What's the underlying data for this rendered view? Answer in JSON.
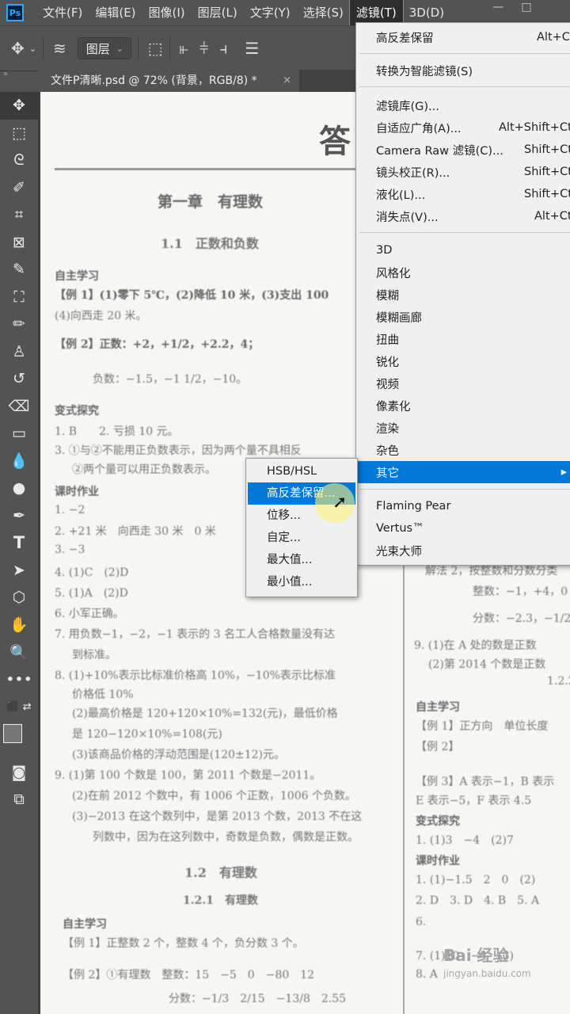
{
  "menubar": {
    "logo": "Ps",
    "items": [
      "文件(F)",
      "编辑(E)",
      "图像(I)",
      "图层(L)",
      "文字(Y)",
      "选择(S)",
      "滤镜(T)",
      "3D(D)"
    ],
    "active_index": 6
  },
  "options_bar": {
    "layer_select_value": "图层"
  },
  "tab": {
    "title": "文件P清晰.psd @ 72% (背景，RGB/8) *",
    "close": "×"
  },
  "toolbox": {
    "tools": [
      "move-tool-icon",
      "marquee-tool-icon",
      "lasso-tool-icon",
      "quick-select-tool-icon",
      "crop-tool-icon",
      "frame-tool-icon",
      "eyedropper-tool-icon",
      "healing-brush-tool-icon",
      "brush-tool-icon",
      "stamp-tool-icon",
      "history-brush-tool-icon",
      "eraser-tool-icon",
      "gradient-tool-icon",
      "blur-tool-icon",
      "dodge-tool-icon",
      "pen-tool-icon",
      "type-tool-icon",
      "path-select-tool-icon",
      "shape-tool-icon",
      "hand-tool-icon",
      "zoom-tool-icon",
      "more-tools-icon"
    ],
    "type_tool_label": "T"
  },
  "filter_menu": {
    "items": [
      {
        "label": "高反差保留",
        "shortcut": "Alt+C"
      },
      {
        "label": "转换为智能滤镜(S)",
        "shortcut": ""
      },
      {
        "label": "滤镜库(G)...",
        "shortcut": ""
      },
      {
        "label": "自适应广角(A)...",
        "shortcut": "Alt+Shift+Ct"
      },
      {
        "label": "Camera Raw 滤镜(C)...",
        "shortcut": "Shift+Ct"
      },
      {
        "label": "镜头校正(R)...",
        "shortcut": "Shift+Ct"
      },
      {
        "label": "液化(L)...",
        "shortcut": "Shift+Ct"
      },
      {
        "label": "消失点(V)...",
        "shortcut": "Alt+Ct"
      },
      {
        "label": "3D",
        "shortcut": ""
      },
      {
        "label": "风格化",
        "shortcut": ""
      },
      {
        "label": "模糊",
        "shortcut": ""
      },
      {
        "label": "模糊画廊",
        "shortcut": ""
      },
      {
        "label": "扭曲",
        "shortcut": ""
      },
      {
        "label": "锐化",
        "shortcut": ""
      },
      {
        "label": "视频",
        "shortcut": ""
      },
      {
        "label": "像素化",
        "shortcut": ""
      },
      {
        "label": "渲染",
        "shortcut": ""
      },
      {
        "label": "杂色",
        "shortcut": ""
      },
      {
        "label": "其它",
        "shortcut": ""
      },
      {
        "label": "Flaming Pear",
        "shortcut": ""
      },
      {
        "label": "Vertus™",
        "shortcut": ""
      },
      {
        "label": "光束大师",
        "shortcut": ""
      }
    ],
    "highlighted": "其它"
  },
  "sub_menu": {
    "items": [
      "HSB/HSL",
      "高反差保留...",
      "位移...",
      "自定...",
      "最大值...",
      "最小值..."
    ],
    "highlighted": "高反差保留..."
  },
  "document": {
    "big_title": "答",
    "chapter": "第一章　有理数",
    "section_1_1": "1.1　正数和负数",
    "lines": [
      "自主学习",
      "【例 1】(1)零下 5℃，(2)降低 10 米，(3)支出 100",
      "(4)向西走 20 米。",
      "【例 2】正数：+2，+1/2，+2.2，4；",
      "负数：−1.5，−1 1/2，−10。",
      "变式探究",
      "1. B　　2. 亏损 10 元。",
      "3. ①与②不能用正负数表示，因为两个量不具相反",
      "②两个量可以用正负数表示。",
      "课时作业",
      "1. −2",
      "2. +21 米　向西走 30 米　0 米",
      "3. −3",
      "4. (1)C　(2)D",
      "5. (1)A　(2)D",
      "6. 小军正确。",
      "7. 用负数−1，−2，−1 表示的 3 名工人合格数量没有达",
      "到标准。",
      "8. (1)+10%表示比标准价格高 10%，−10%表示比标准",
      "价格低 10%",
      "(2)最高价格是 120+120×10%=132(元)，最低价格",
      "是 120−120×10%=108(元)",
      "(3)该商品价格的浮动范围是(120±12)元。",
      "9. (1)第 100 个数是 100，第 2011 个数是−2011。",
      "(2)在前 2012 个数中，有 1006 个正数，1006 个负数。",
      "(3)−2013 在这个数列中，是第 2013 个数，2013 不在这",
      "列数中，因为在这列数中，奇数是负数，偶数是正数。"
    ],
    "section_1_2": "1.2　有理数",
    "section_1_2_1": "1.2.1　有理数",
    "lines_bottom": [
      "自主学习",
      "【例 1】正整数 2 个，整数 4 个，负分数 3 个。",
      "【例 2】①有理数　整数：15　−5　0　−80　12",
      "分数：−1/3　2/15　−13/8　2.55"
    ],
    "right_col": [
      "解法 2，按整数和分数分类",
      "整数：−1，+4，0",
      "分数：−2.3，−1/2",
      "9. (1)在 A 处的数是正数",
      "(2)第 2014 个数是正数",
      "1.2.2",
      "自主学习",
      "【例 1】正方向　单位长度",
      "【例 2】",
      "【例 3】A 表示−1，B 表示",
      "E 表示−5，F 表示 4.5",
      "变式探究",
      "1. (1)3　−4　(2)7",
      "课时作业",
      "1. (1)−1.5　2　0　(2)",
      "2. D　3. D　4. B　5. A",
      "6.",
      "7. (1)10　−4　(3)",
      "8. A"
    ]
  },
  "watermark": {
    "text": "Bai 经验",
    "sub": "jingyan.baidu.com"
  }
}
